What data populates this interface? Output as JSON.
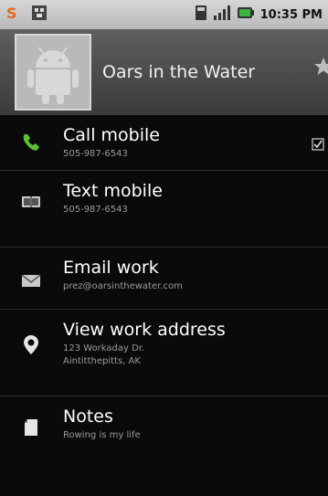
{
  "status_bar": {
    "time": "10:35 PM"
  },
  "contact": {
    "name": "Oars in the Water"
  },
  "actions": [
    {
      "title": "Call mobile",
      "lines": [
        "505-987-6543"
      ],
      "icon": "phone-icon"
    },
    {
      "title": "Text mobile",
      "lines": [
        "505-987-6543"
      ],
      "icon": "message-icon"
    },
    {
      "title": "Email work",
      "lines": [
        "prez@oarsinthewater.com"
      ],
      "icon": "envelope-icon"
    },
    {
      "title": "View work address",
      "lines": [
        "123 Workaday Dr.",
        "Aintitthepitts, AK"
      ],
      "icon": "map-pin-icon"
    },
    {
      "title": "Notes",
      "lines": [
        "Rowing is my life"
      ],
      "icon": "note-icon"
    }
  ],
  "colors": {
    "accent_phone": "#5bc236",
    "header_bg": "#4a4a4a",
    "status_bg": "#c8c8c8"
  }
}
